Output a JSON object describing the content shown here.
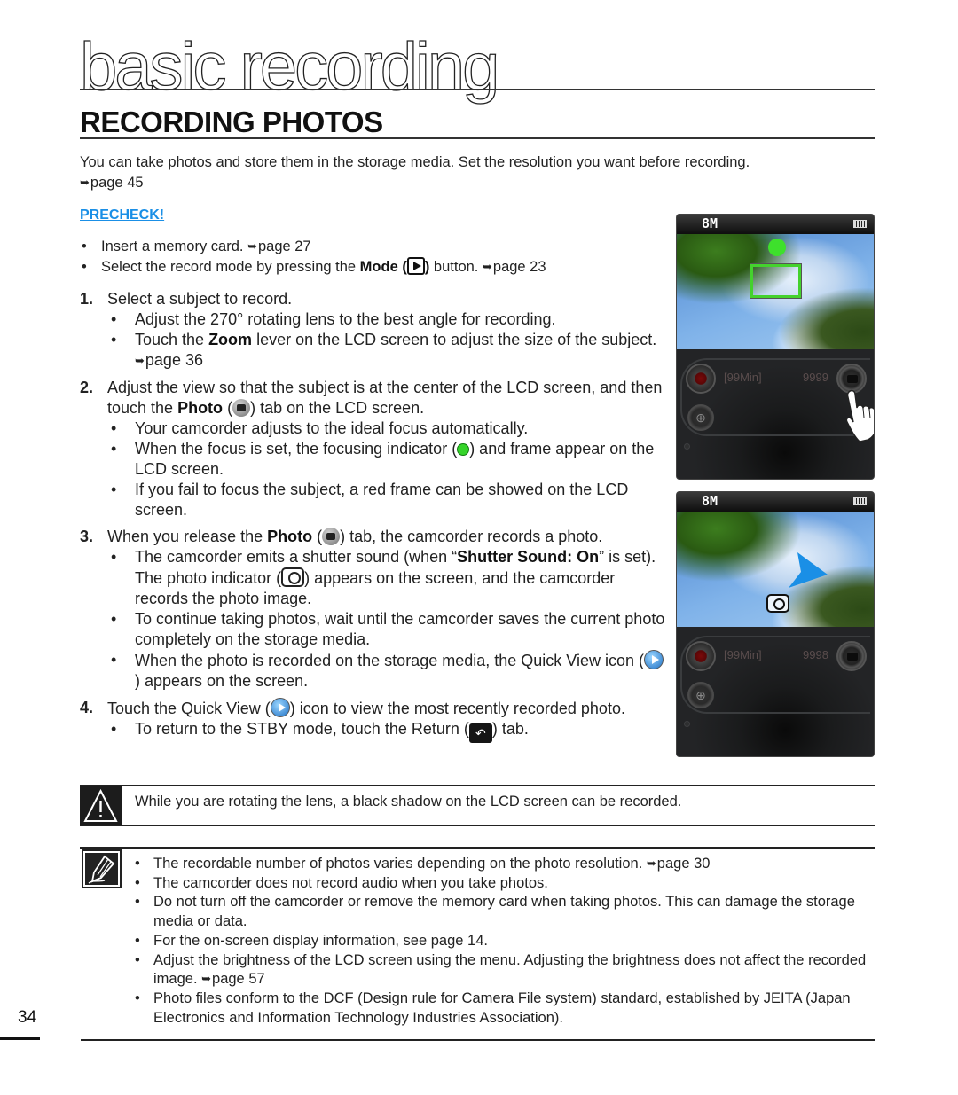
{
  "chapter": {
    "title": "basic recording"
  },
  "section": {
    "title": "RECORDING PHOTOS"
  },
  "intro": {
    "text": "You can take photos and store them in the storage media. Set the resolution you want before recording.",
    "ref": "page 45"
  },
  "precheck": {
    "label": "PRECHECK!",
    "color": "#1a8fe6",
    "items": [
      {
        "text": "Insert a memory card.",
        "ref": "page 27"
      },
      {
        "pre": "Select the record mode by pressing the ",
        "bold": "Mode (",
        "bold_end": ")",
        "post": " button.",
        "icon": "mode-play-icon",
        "ref": "page 23"
      }
    ]
  },
  "steps": [
    {
      "num": "1.",
      "text": "Select a subject to record.",
      "subs": [
        {
          "text": "Adjust the 270° rotating lens to the best angle for recording."
        },
        {
          "pre": "Touch the ",
          "bold": "Zoom",
          "post": " lever on the LCD screen to adjust the size of the subject.",
          "ref": "page 36"
        }
      ]
    },
    {
      "num": "2.",
      "pre": "Adjust the view so that the subject is at the center of the LCD screen, and then touch the ",
      "bold": "Photo",
      "post": " tab on the LCD screen.",
      "icon": "photo-tab-icon",
      "subs": [
        {
          "text": "Your camcorder adjusts to the ideal focus automatically."
        },
        {
          "pre": "When the focus is set, the focusing indicator (",
          "post": ") and frame appear on the LCD screen.",
          "icon": "focus-indicator-icon"
        },
        {
          "text": "If you fail to focus the subject, a red frame can be showed on the LCD screen."
        }
      ]
    },
    {
      "num": "3.",
      "pre": "When you release the ",
      "bold": "Photo",
      "post": " tab, the camcorder records a photo.",
      "icon": "photo-tab-icon",
      "subs": [
        {
          "pre": "The camcorder emits a shutter sound (when “",
          "bold": "Shutter Sound: On",
          "mid": "” is set). The photo indicator (",
          "post": ") appears on the screen, and the camcorder records the photo image.",
          "icon": "photo-indicator-icon"
        },
        {
          "text": "To continue taking photos, wait until the camcorder saves the current photo completely on the storage media."
        },
        {
          "pre": "When the photo is recorded on the storage media, the Quick View icon (",
          "post": ") appears on the screen.",
          "icon": "quick-view-icon"
        }
      ]
    },
    {
      "num": "4.",
      "pre": "Touch the Quick View (",
      "post": ") icon to view the most recently recorded photo.",
      "icon": "quick-view-icon",
      "subs": [
        {
          "pre": "To return to the STBY mode, touch the Return (",
          "post": ") tab.",
          "icon": "return-icon"
        }
      ]
    }
  ],
  "screens": [
    {
      "resolution": "8M",
      "remaining_time": "[99Min]",
      "photo_count": "9999",
      "focus_color": "#3ee02c",
      "state": "focusing"
    },
    {
      "resolution": "8M",
      "remaining_time": "[99Min]",
      "photo_count": "9998",
      "pointer_color": "#1a8fe6",
      "state": "captured"
    }
  ],
  "warning": {
    "icon": "warning-triangle-icon",
    "text": "While you are rotating the lens, a black shadow on the LCD screen can be recorded."
  },
  "notes": {
    "icon": "note-pencil-icon",
    "items": [
      {
        "text": "The recordable number of photos varies depending on the photo resolution.",
        "ref": "page 30"
      },
      {
        "text": "The camcorder does not record audio when you take photos."
      },
      {
        "text": "Do not turn off the camcorder or remove the memory card when taking photos. This can damage the storage media or data."
      },
      {
        "text": "For the on-screen display information, see page 14."
      },
      {
        "text": "Adjust the brightness of the LCD screen using the menu. Adjusting the brightness does not affect the recorded image.",
        "ref": "page 57"
      },
      {
        "text": "Photo files conform to the DCF (Design rule for Camera File system) standard, established by JEITA (Japan Electronics and Information Technology Industries Association)."
      }
    ]
  },
  "page": {
    "number": "34"
  },
  "ref_arrow": "➥"
}
